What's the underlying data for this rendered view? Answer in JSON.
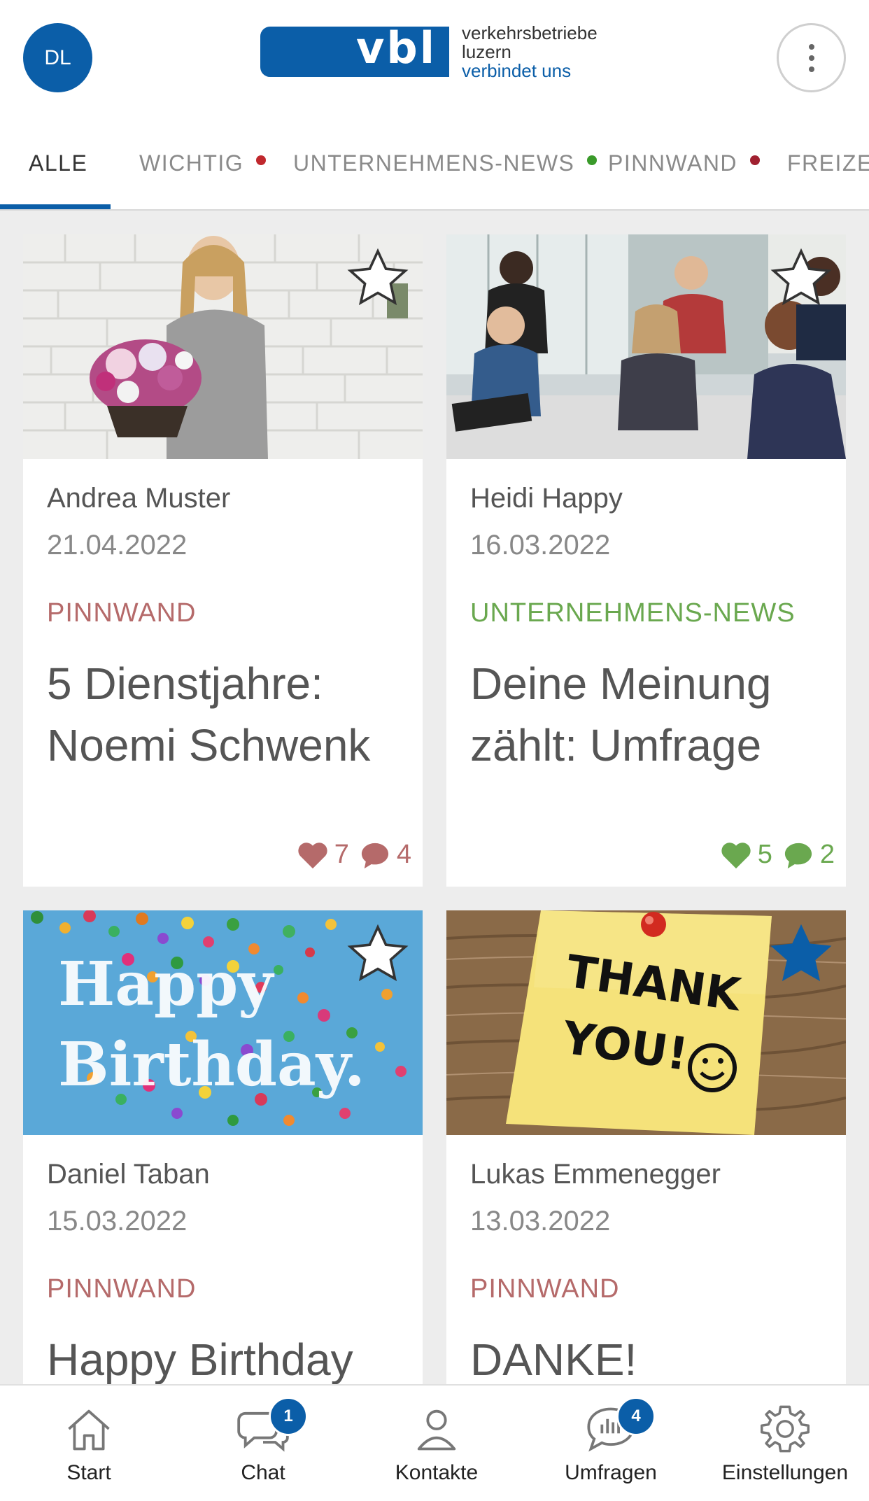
{
  "header": {
    "avatar_initials": "DL",
    "logo_mark": "vbl",
    "logo_line1": "verkehrsbetriebe",
    "logo_line2": "luzern",
    "logo_tagline": "verbindet uns"
  },
  "tabs": [
    {
      "label": "ALLE",
      "active": true
    },
    {
      "label": "WICHTIG",
      "dot": "#c0282d"
    },
    {
      "label": "UNTERNEHMENS-NEWS",
      "dot": "#3a9a2a"
    },
    {
      "label": "PINNWAND",
      "dot": "#a02030"
    },
    {
      "label": "FREIZEI"
    }
  ],
  "cards": [
    {
      "author": "Andrea Muster",
      "date": "21.04.2022",
      "category": "PINNWAND",
      "category_color": "#b56a6a",
      "title": "5 Dienstjahre: Noemi Schwenk",
      "likes": "7",
      "comments": "4",
      "favorite": false,
      "image": "woman-with-flowers"
    },
    {
      "author": "Heidi Happy",
      "date": "16.03.2022",
      "category": "UNTERNEHMENS-NEWS",
      "category_color": "#6aa84f",
      "title": "Deine Meinung zählt: Umfrage",
      "likes": "5",
      "comments": "2",
      "favorite": false,
      "image": "office-meeting"
    },
    {
      "author": "Daniel Taban",
      "date": "15.03.2022",
      "category": "PINNWAND",
      "category_color": "#b56a6a",
      "title": "Happy Birthday",
      "favorite": false,
      "image": "happy-birthday-confetti",
      "image_text_line1": "Happy",
      "image_text_line2": "Birthday."
    },
    {
      "author": "Lukas Emmenegger",
      "date": "13.03.2022",
      "category": "PINNWAND",
      "category_color": "#b56a6a",
      "title": "DANKE!",
      "favorite": true,
      "image": "thank-you-note",
      "image_text_line1": "THANK",
      "image_text_line2": "YOU!"
    }
  ],
  "bottom_nav": [
    {
      "label": "Start",
      "icon": "home-icon"
    },
    {
      "label": "Chat",
      "icon": "chat-icon",
      "badge": "1"
    },
    {
      "label": "Kontakte",
      "icon": "contacts-icon"
    },
    {
      "label": "Umfragen",
      "icon": "survey-icon",
      "badge": "4"
    },
    {
      "label": "Einstellungen",
      "icon": "gear-icon"
    }
  ],
  "colors": {
    "brand_blue": "#0b5ea8",
    "pinnwand": "#b56a6a",
    "news_green": "#6aa84f"
  }
}
